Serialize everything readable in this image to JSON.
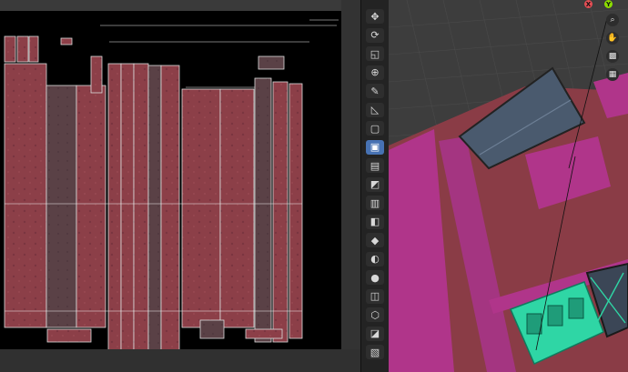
{
  "uv_editor": {
    "colors": {
      "background": "#000000",
      "frame": "#383838",
      "island_fill": "#8c3f48",
      "island_fill_dark": "#5a4146",
      "island_edge": "#dddddd"
    }
  },
  "toolbar": {
    "tools": [
      {
        "name": "move-view-icon",
        "glyph": "✥"
      },
      {
        "name": "rotate-icon",
        "glyph": "⟳"
      },
      {
        "name": "scale-icon",
        "glyph": "◱"
      },
      {
        "name": "transform-icon",
        "glyph": "⊕"
      },
      {
        "name": "annotate-icon",
        "glyph": "✎"
      },
      {
        "name": "measure-icon",
        "glyph": "◺"
      },
      {
        "name": "add-cube-icon",
        "glyph": "▢"
      },
      {
        "name": "extrude-icon",
        "glyph": "▣",
        "active": true
      },
      {
        "name": "inset-icon",
        "glyph": "▤"
      },
      {
        "name": "bevel-icon",
        "glyph": "◩"
      },
      {
        "name": "loop-cut-icon",
        "glyph": "▥"
      },
      {
        "name": "knife-icon",
        "glyph": "◧"
      },
      {
        "name": "poly-build-icon",
        "glyph": "◆"
      },
      {
        "name": "spin-icon",
        "glyph": "◐"
      },
      {
        "name": "smooth-icon",
        "glyph": "●"
      },
      {
        "name": "edge-slide-icon",
        "glyph": "◫"
      },
      {
        "name": "shrink-fatten-icon",
        "glyph": "⬡"
      },
      {
        "name": "shear-icon",
        "glyph": "◪"
      },
      {
        "name": "rip-region-icon",
        "glyph": "▧"
      }
    ],
    "accent": "#4772b3"
  },
  "viewport": {
    "gizmo": {
      "axes": [
        {
          "label": "X",
          "color": "#e34d54"
        },
        {
          "label": "Y",
          "color": "#8bdc00"
        }
      ],
      "buttons": [
        {
          "name": "zoom-icon",
          "glyph": "⌕"
        },
        {
          "name": "pan-hand-icon",
          "glyph": "✋"
        },
        {
          "name": "camera-icon",
          "glyph": "▩"
        },
        {
          "name": "grid-icon",
          "glyph": "▦"
        }
      ]
    },
    "colors": {
      "background": "#3d3d3d",
      "mesh_red": "#8a3c46",
      "mesh_magenta": "#b0358a",
      "selected_green": "#2fd6a5",
      "window_glass": "#4a5a6e"
    }
  }
}
